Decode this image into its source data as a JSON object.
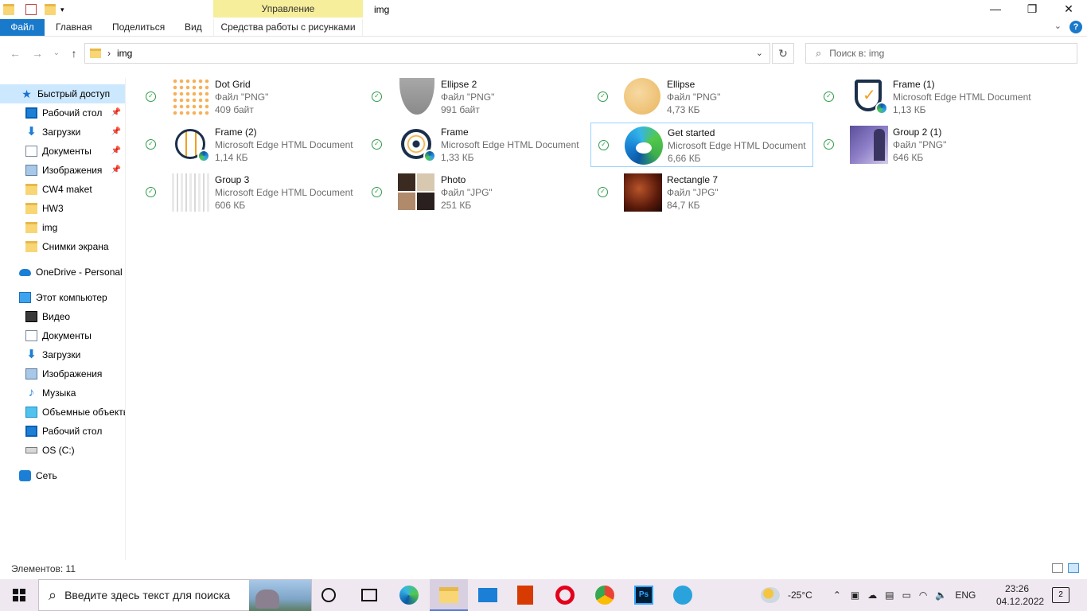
{
  "window": {
    "title": "img",
    "manage_label": "Управление",
    "min": "—",
    "restore": "❐",
    "close": "✕"
  },
  "ribbon": {
    "file": "Файл",
    "home": "Главная",
    "share": "Поделиться",
    "view": "Вид",
    "tools": "Средства работы с рисунками"
  },
  "address": {
    "back": "←",
    "forward": "→",
    "recent": "⌄",
    "up": "↑",
    "path": "img",
    "dropdown": "⌄",
    "refresh": "↻",
    "search_placeholder": "Поиск в: img"
  },
  "sidebar": {
    "items": [
      {
        "label": "Быстрый доступ"
      },
      {
        "label": "Рабочий стол"
      },
      {
        "label": "Загрузки"
      },
      {
        "label": "Документы"
      },
      {
        "label": "Изображения"
      },
      {
        "label": "CW4 maket"
      },
      {
        "label": "HW3"
      },
      {
        "label": "img"
      },
      {
        "label": "Снимки экрана"
      },
      {
        "label": "OneDrive - Personal"
      },
      {
        "label": "Этот компьютер"
      },
      {
        "label": "Видео"
      },
      {
        "label": "Документы"
      },
      {
        "label": "Загрузки"
      },
      {
        "label": "Изображения"
      },
      {
        "label": "Музыка"
      },
      {
        "label": "Объемные объекты"
      },
      {
        "label": "Рабочий стол"
      },
      {
        "label": "OS (C:)"
      },
      {
        "label": "Сеть"
      }
    ]
  },
  "files": [
    {
      "name": "Dot Grid",
      "type": "Файл \"PNG\"",
      "size": "409 байт"
    },
    {
      "name": "Ellipse 2",
      "type": "Файл \"PNG\"",
      "size": "991 байт"
    },
    {
      "name": "Ellipse",
      "type": "Файл \"PNG\"",
      "size": "4,73 КБ"
    },
    {
      "name": "Frame (1)",
      "type": "Microsoft Edge HTML Document",
      "size": "1,13 КБ"
    },
    {
      "name": "Frame (2)",
      "type": "Microsoft Edge HTML Document",
      "size": "1,14 КБ"
    },
    {
      "name": "Frame",
      "type": "Microsoft Edge HTML Document",
      "size": "1,33 КБ"
    },
    {
      "name": "Get started",
      "type": "Microsoft Edge HTML Document",
      "size": "6,66 КБ"
    },
    {
      "name": "Group 2 (1)",
      "type": "Файл \"PNG\"",
      "size": "646 КБ"
    },
    {
      "name": "Group 3",
      "type": "Microsoft Edge HTML Document",
      "size": "606 КБ"
    },
    {
      "name": "Photo",
      "type": "Файл \"JPG\"",
      "size": "251 КБ"
    },
    {
      "name": "Rectangle 7",
      "type": "Файл \"JPG\"",
      "size": "84,7 КБ"
    }
  ],
  "status": {
    "count": "Элементов: 11"
  },
  "taskbar": {
    "search_placeholder": "Введите здесь текст для поиска",
    "temperature": "-25°C",
    "lang": "ENG",
    "time": "23:26",
    "date": "04.12.2022",
    "notifications": "2"
  }
}
